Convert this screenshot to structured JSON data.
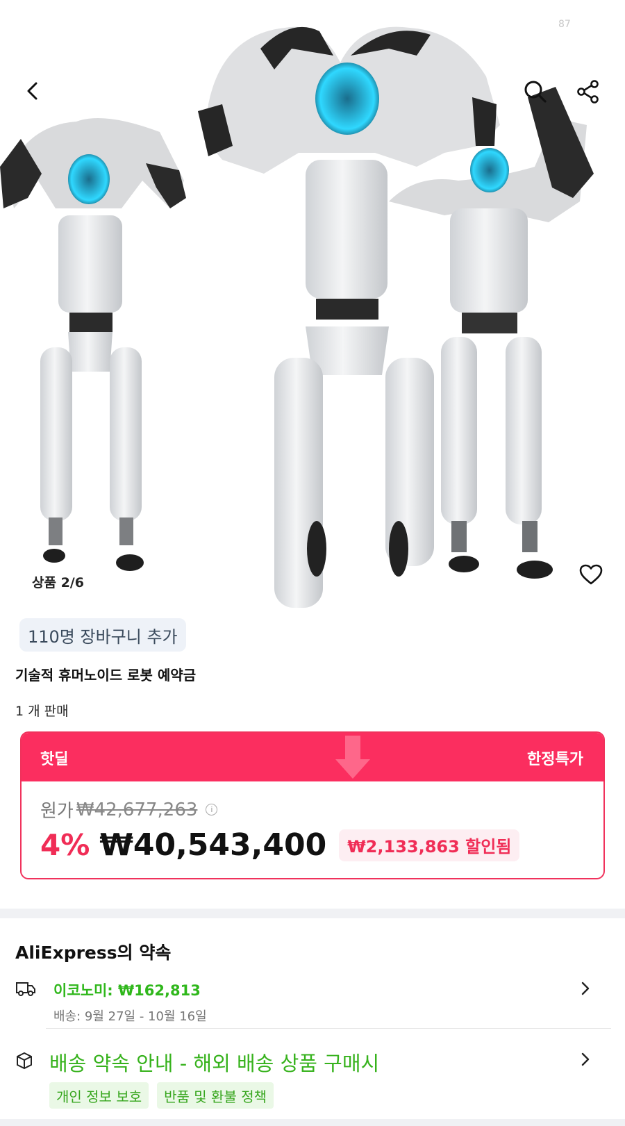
{
  "status_bar": {
    "number": "87"
  },
  "header": {
    "back_icon": "chevron-left-icon",
    "search_icon": "search-icon",
    "share_icon": "share-icon"
  },
  "gallery": {
    "counter": "상품 2/6",
    "wishlist_icon": "heart-outline-icon"
  },
  "product": {
    "cart_badge": "110명 장바구니 추가",
    "title": "기술적 휴머노이드 로봇 예약금",
    "sold": "1 개 판매"
  },
  "deal": {
    "left_label": "핫딜",
    "right_label": "한정특가",
    "original_label": "원가",
    "original_price": "₩42,677,263",
    "info_icon": "info-icon",
    "discount": "4%",
    "price": "₩40,543,400",
    "saved": "₩2,133,863 할인됨",
    "accent_color": "#fb2e5f"
  },
  "promise": {
    "title": "AliExpress의 약속",
    "shipping": {
      "icon": "truck-icon",
      "label": "이코노미: ₩162,813",
      "delivery": "배송: 9월 27일 - 10월 16일"
    },
    "guide": {
      "icon": "box-icon",
      "label": "배송 약속 안내 - 해외 배송 상품 구매시",
      "tags": [
        "개인 정보 보호",
        "반품 및 환불 정책"
      ]
    },
    "green_color": "#2fb71b"
  }
}
